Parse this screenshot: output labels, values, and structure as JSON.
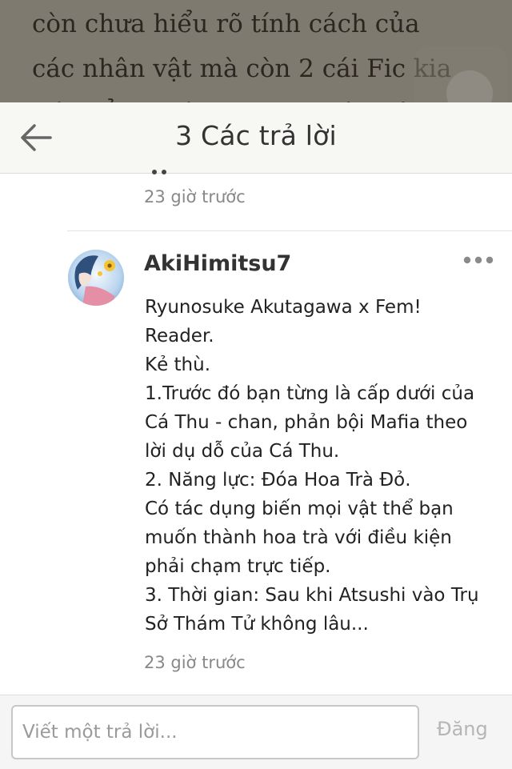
{
  "background_page": {
    "lines": [
      "còn chưa hiểu rõ tính cách của",
      "các nhân vật mà còn 2 cái Fic kia",
      "thì chẳng thèm update nên cái fic"
    ]
  },
  "header": {
    "back_icon": "arrow-left-icon",
    "title": "3 Các trả lời"
  },
  "previous_comment": {
    "time": "23 giờ trước"
  },
  "comment": {
    "avatar_icon": "user-avatar",
    "username": "AkiHimitsu7",
    "more_icon": "more-horizontal-icon",
    "lines": [
      "Ryunosuke Akutagawa x Fem!",
      "Reader.",
      "Kẻ thù.",
      "1.Trước đó bạn từng là cấp  dưới của",
      "Cá Thu - chan, phản bội Mafia theo",
      "lời dụ dỗ của Cá Thu.",
      "2. Năng lực: Đóa Hoa Trà Đỏ.",
      "Có tác dụng biến mọi vật thể bạn",
      "muốn thành hoa trà với điều kiện",
      "phải chạm trực tiếp.",
      "3. Thời gian: Sau khi Atsushi vào Trụ",
      "Sở Thám Tử không lâu..."
    ],
    "time": "23 giờ trước"
  },
  "composer": {
    "placeholder": "Viết một trả lời...",
    "post_label": "Đăng"
  },
  "colors": {
    "overlay": "#7f7a70",
    "header_bg": "#f7f7f4",
    "muted_text": "#888888",
    "post_disabled": "#b5b5b5"
  }
}
